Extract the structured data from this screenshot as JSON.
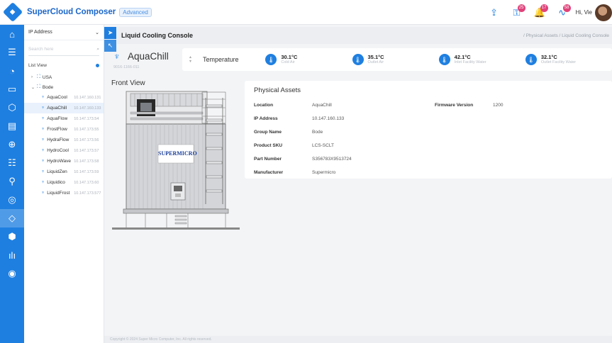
{
  "header": {
    "brand": "SuperCloud Composer",
    "edition": "Advanced",
    "greeting": "Hi, Vie",
    "icons": [
      {
        "name": "upload-icon",
        "glyph": "⇪",
        "badge": ""
      },
      {
        "name": "key-icon",
        "glyph": "⚿",
        "badge": "25"
      },
      {
        "name": "bell-icon",
        "glyph": "🔔",
        "badge": "17"
      },
      {
        "name": "activity-icon",
        "glyph": "∿",
        "badge": "58"
      }
    ]
  },
  "rail": [
    {
      "name": "home-icon",
      "glyph": "⌂"
    },
    {
      "name": "servers-icon",
      "glyph": "☰"
    },
    {
      "name": "dashboard-icon",
      "glyph": "◔"
    },
    {
      "name": "monitor-icon",
      "glyph": "▭"
    },
    {
      "name": "cube-icon",
      "glyph": "⬡"
    },
    {
      "name": "storage-icon",
      "glyph": "▤"
    },
    {
      "name": "network-icon",
      "glyph": "⊕"
    },
    {
      "name": "database-icon",
      "glyph": "☷"
    },
    {
      "name": "topology-icon",
      "glyph": "⚲"
    },
    {
      "name": "diagnostics-icon",
      "glyph": "◎"
    },
    {
      "name": "cooling-icon",
      "glyph": "◇"
    },
    {
      "name": "hexagon-icon",
      "glyph": "⬢"
    },
    {
      "name": "analytics-icon",
      "glyph": "ılı"
    },
    {
      "name": "security-icon",
      "glyph": "◉"
    }
  ],
  "tree": {
    "selector": "IP Address",
    "search_placeholder": "Search here",
    "list_view": "List View",
    "groups": [
      {
        "name": "USA",
        "expanded": false
      },
      {
        "name": "Bode",
        "expanded": true
      }
    ],
    "leaves": [
      {
        "name": "AquaCool",
        "ip": "10.147.160.131"
      },
      {
        "name": "AquaChill",
        "ip": "10.147.160.133"
      },
      {
        "name": "AquaFlow",
        "ip": "10.147.173.54"
      },
      {
        "name": "FrostFlow",
        "ip": "10.147.173.55"
      },
      {
        "name": "HydraFlow",
        "ip": "10.147.173.56"
      },
      {
        "name": "HydroCool",
        "ip": "10.147.173.57"
      },
      {
        "name": "HydroWave",
        "ip": "10.147.173.58"
      },
      {
        "name": "LiquidZen",
        "ip": "10.147.173.59"
      },
      {
        "name": "Liquidico",
        "ip": "10.147.173.60"
      },
      {
        "name": "LiquidFrost",
        "ip": "10.147.173.577"
      }
    ],
    "selected_index": 1
  },
  "main": {
    "title": "Liquid Cooling Console",
    "breadcrumb": "/ Physical Assets / Liquid Cooling Console",
    "device": {
      "name": "AquaChill",
      "subtitle": "9016-1166-011"
    },
    "metrics_label": "Temperature",
    "metrics": [
      {
        "value": "30.1°C",
        "label": "Cold Air"
      },
      {
        "value": "35.1°C",
        "label": "Outlet Air"
      },
      {
        "value": "42.1°C",
        "label": "Inlet Facility Water"
      },
      {
        "value": "32.1°C",
        "label": "Outlet Facility Water"
      }
    ],
    "front_view": "Front View",
    "rack_logo": "SUPERMICRO",
    "assets": {
      "title": "Physical Assets",
      "left": [
        {
          "key": "Location",
          "value": "AquaChill"
        },
        {
          "key": "IP Address",
          "value": "10.147.160.133"
        },
        {
          "key": "Group Name",
          "value": "Bode"
        },
        {
          "key": "Product SKU",
          "value": "LCS-SCLT"
        },
        {
          "key": "Part Number",
          "value": "S356783X9513724"
        },
        {
          "key": "Manufacturer",
          "value": "Supermicro"
        }
      ],
      "right": [
        {
          "key": "Firmware Version",
          "value": "1200"
        }
      ]
    },
    "footer": "Copyright © 2024 Super Micro Computer, Inc. All rights reserved."
  }
}
